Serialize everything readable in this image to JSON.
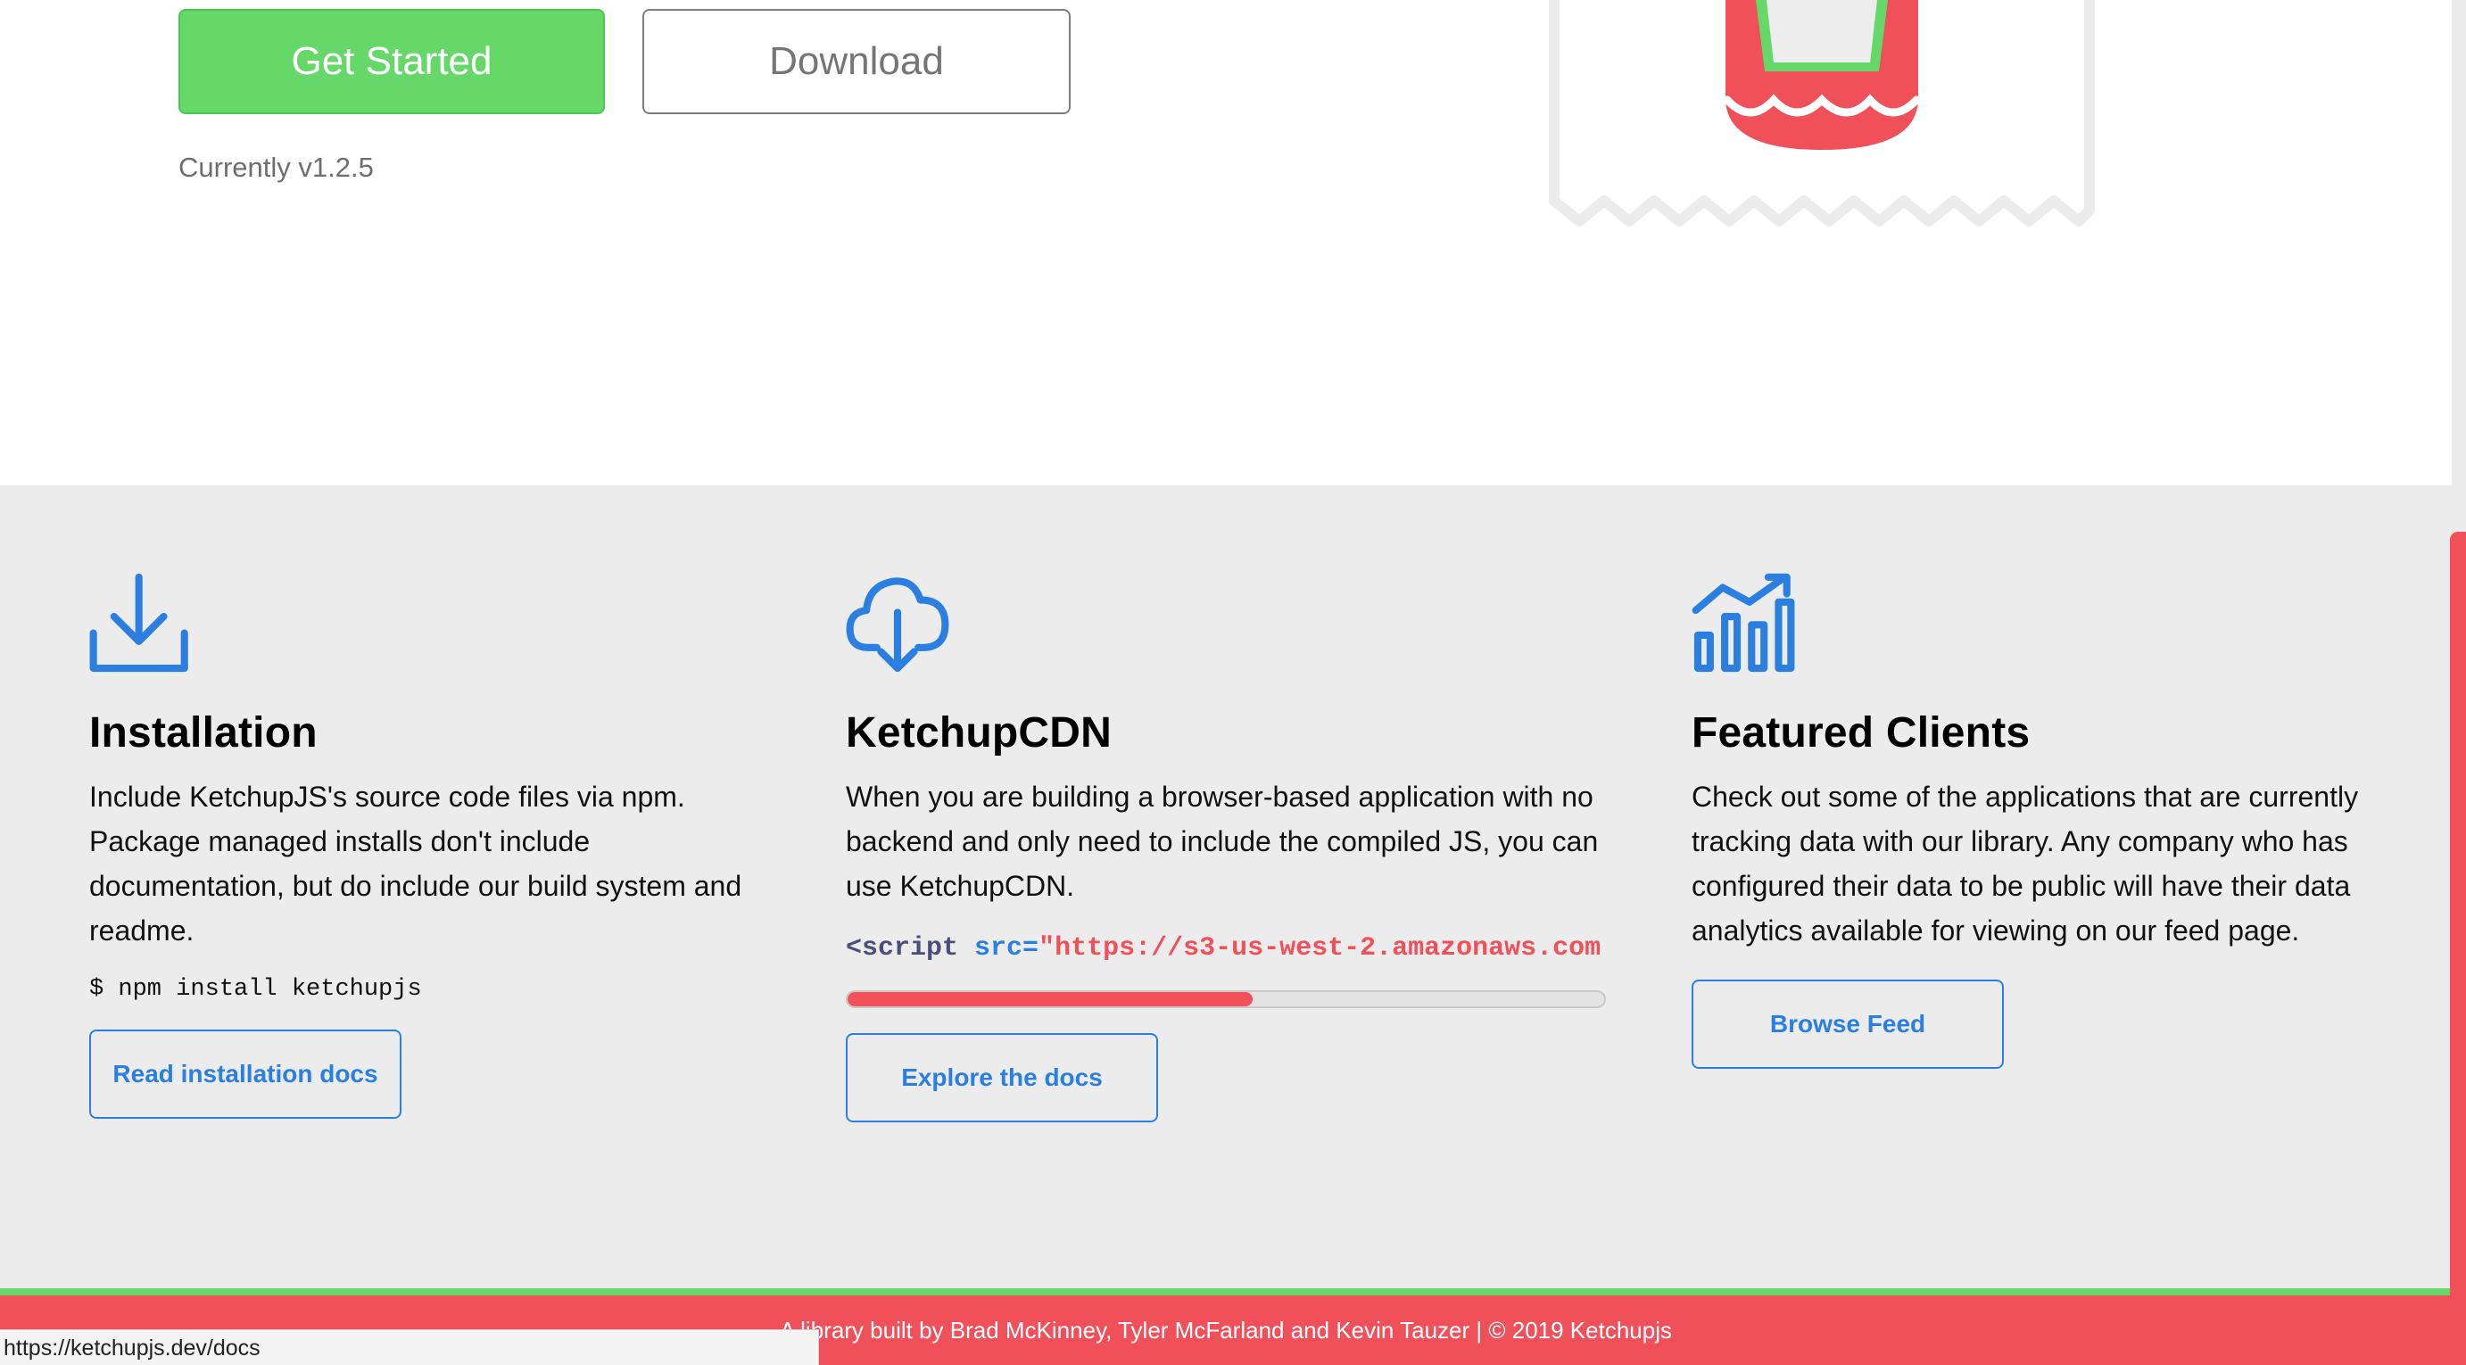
{
  "hero": {
    "get_started_label": "Get Started",
    "download_label": "Download",
    "version_text": "Currently v1.2.5"
  },
  "features": [
    {
      "icon": "download-icon",
      "title": "Installation",
      "description": "Include KetchupJS's source code files via npm. Package managed installs don't include documentation, but do include our build system and readme.",
      "code": "$ npm install ketchupjs",
      "button_label": "Read installation docs"
    },
    {
      "icon": "cloud-download-icon",
      "title": "KetchupCDN",
      "description": "When you are building a browser-based application with no backend and only need to include the compiled JS, you can use KetchupCDN.",
      "code": {
        "tag": "<script",
        "attr": "src=",
        "value": "\"https://s3-us-west-2.amazonaws.com"
      },
      "scroll_progress_percent": 53.5,
      "button_label": "Explore the docs"
    },
    {
      "icon": "chart-growth-icon",
      "title": "Featured Clients",
      "description": "Check out some of the applications that are currently tracking data with our library. Any company who has configured their data to be public will have their data analytics available for viewing on our feed page.",
      "button_label": "Browse Feed"
    }
  ],
  "footer": {
    "text": "A library built by Brad McKinney, Tyler McFarland and Kevin Tauzer | © 2019 Ketchupjs"
  },
  "status_bar": {
    "url": "https://ketchupjs.dev/docs"
  },
  "colors": {
    "primary_green": "#66d86a",
    "ketchup_red": "#f0505a",
    "link_blue": "#2a7fe0",
    "section_gray": "#ececed"
  }
}
